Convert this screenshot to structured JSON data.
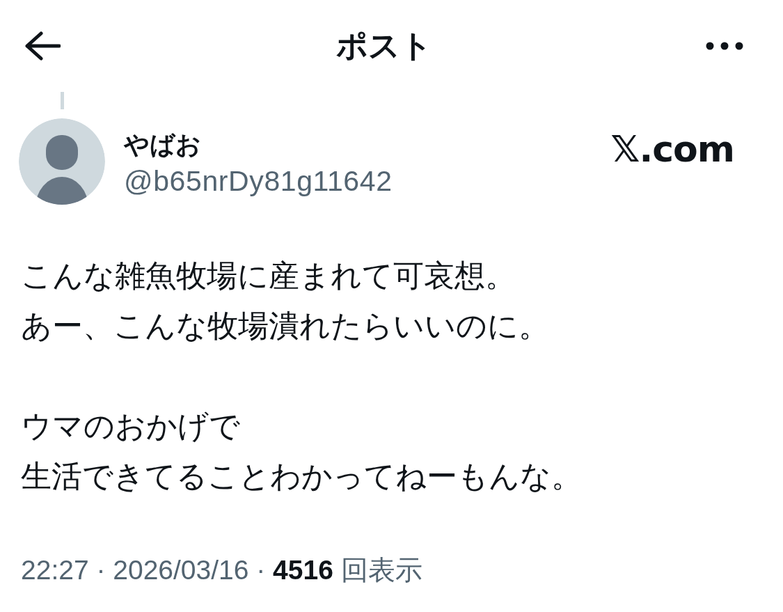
{
  "header": {
    "title": "ポスト"
  },
  "post": {
    "thread_line_above": true,
    "author": {
      "name": "やばお",
      "handle": "@b65nrDy81g11642"
    },
    "source_label": "𝕏.com",
    "paragraphs": [
      [
        "こんな雑魚牧場に産まれて可哀想。",
        "あー、こんな牧場潰れたらいいのに。"
      ],
      [
        "ウマのおかげで",
        "生活できてることわかってねーもんな。"
      ]
    ],
    "meta": "22:27 · 2026/03/16 · **4516** 回表示"
  }
}
